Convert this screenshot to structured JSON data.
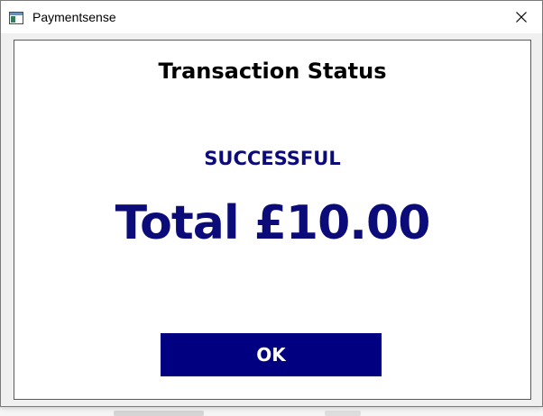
{
  "window": {
    "title": "Paymentsense",
    "icon": "app-window-icon",
    "close_icon": "close-icon"
  },
  "dialog": {
    "heading": "Transaction Status",
    "status": "SUCCESSFUL",
    "total": "Total £10.00",
    "ok_label": "OK"
  },
  "colors": {
    "accent": "#000080",
    "status_text": "#0b0b7a"
  }
}
